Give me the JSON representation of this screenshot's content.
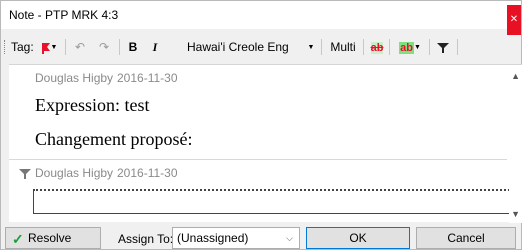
{
  "window": {
    "title": "Note - PTP MRK 4:3"
  },
  "toolbar": {
    "tag_label": "Tag:",
    "bold": "B",
    "italic": "I",
    "language": "Hawai'i Creole Eng",
    "multi": "Multi",
    "highlight_text": "ab",
    "highlight_text2": "ab"
  },
  "note": {
    "entries": [
      {
        "author": "Douglas Higby",
        "date": "2016-11-30",
        "lines": [
          "Expression: test",
          "Changement proposé:"
        ]
      },
      {
        "author": "Douglas Higby",
        "date": "2016-11-30",
        "lines": []
      }
    ],
    "reply_value": ""
  },
  "footer": {
    "resolve_label": "Resolve",
    "assign_label": "Assign To:",
    "assign_value": "(Unassigned)",
    "ok_label": "OK",
    "cancel_label": "Cancel"
  },
  "colors": {
    "accent": "#0078d7",
    "tag_red": "#e8102a",
    "close_red": "#e81123",
    "resolve_green": "#1a9f3a"
  }
}
